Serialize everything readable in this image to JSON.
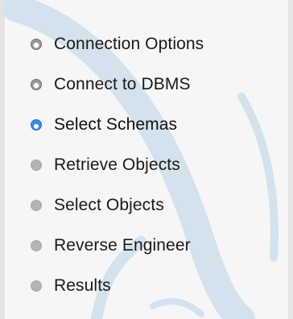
{
  "wizard": {
    "steps": [
      {
        "label": "Connection Options",
        "state": "done"
      },
      {
        "label": "Connect to DBMS",
        "state": "done"
      },
      {
        "label": "Select Schemas",
        "state": "current"
      },
      {
        "label": "Retrieve Objects",
        "state": "pending"
      },
      {
        "label": "Select Objects",
        "state": "pending"
      },
      {
        "label": "Reverse Engineer",
        "state": "pending"
      },
      {
        "label": "Results",
        "state": "pending"
      }
    ]
  },
  "colors": {
    "current_step": "#3d8bec",
    "done_step": "#9a9a9a",
    "pending_step": "#b4b4b4",
    "watermark": "#c9dbe8"
  }
}
